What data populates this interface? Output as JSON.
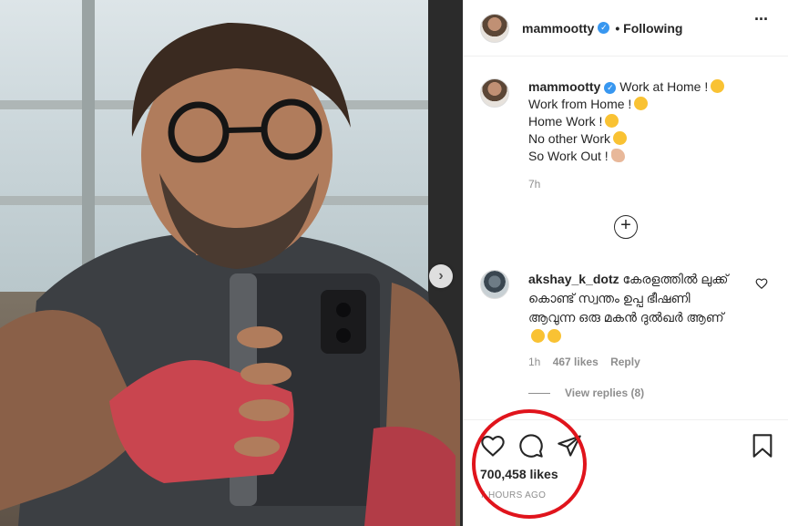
{
  "post": {
    "username": "mammootty",
    "follow_status": "• Following",
    "caption_lines": [
      "Work at Home !",
      "Work from Home !",
      "Home Work !",
      "No other Work",
      "So Work Out !"
    ],
    "time_ago": "7h"
  },
  "comment": {
    "username": "akshay_k_dotz",
    "text": "കേരളത്തിൽ ലുക്ക് കൊണ്ട് സ്വന്തം ഉപ്പ ഭീഷണി ആവുന്ന ഒരു മകൻ ദുൽഖർ ആണ്",
    "time": "1h",
    "likes": "467 likes",
    "reply": "Reply"
  },
  "view_replies": "View replies (8)",
  "likes_count": "700,458 likes",
  "posted_time": "7 HOURS AGO",
  "colors": {
    "verified": "#3897f0",
    "annotation_circle": "#e0141c",
    "text": "#262626",
    "muted": "#8e8e8e"
  },
  "icons": [
    "more-icon",
    "verified-icon",
    "add-comment-icon",
    "heart-icon",
    "comment-icon",
    "share-icon",
    "bookmark-icon",
    "next-photo-icon"
  ]
}
